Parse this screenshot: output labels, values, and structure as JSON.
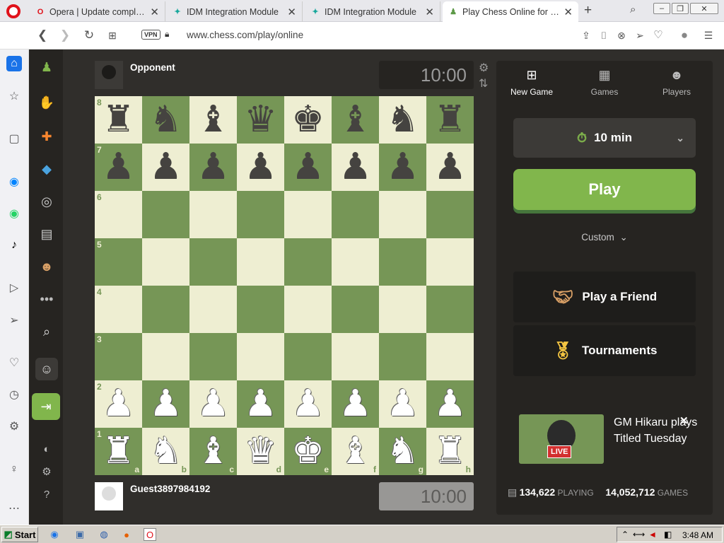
{
  "browser": {
    "tabs": [
      {
        "title": "Opera | Update complete",
        "icon": "opera-icon",
        "active": false
      },
      {
        "title": "IDM Integration Module",
        "icon": "idm-icon",
        "active": false
      },
      {
        "title": "IDM Integration Module",
        "icon": "idm-icon",
        "active": false
      },
      {
        "title": "Play Chess Online for FREE",
        "icon": "chess-pawn-icon",
        "active": true
      }
    ],
    "new_tab": "+",
    "url": "www.chess.com/play/online",
    "vpn_label": "VPN"
  },
  "game": {
    "opponent": {
      "name": "Opponent",
      "clock": "10:00"
    },
    "player": {
      "name": "Guest3897984192",
      "clock": "10:00"
    },
    "files": [
      "a",
      "b",
      "c",
      "d",
      "e",
      "f",
      "g",
      "h"
    ],
    "ranks": [
      "8",
      "7",
      "6",
      "5",
      "4",
      "3",
      "2",
      "1"
    ],
    "position": [
      [
        "r",
        "n",
        "b",
        "q",
        "k",
        "b",
        "n",
        "r"
      ],
      [
        "p",
        "p",
        "p",
        "p",
        "p",
        "p",
        "p",
        "p"
      ],
      [
        "",
        "",
        "",
        "",
        "",
        "",
        "",
        ""
      ],
      [
        "",
        "",
        "",
        "",
        "",
        "",
        "",
        ""
      ],
      [
        "",
        "",
        "",
        "",
        "",
        "",
        "",
        ""
      ],
      [
        "",
        "",
        "",
        "",
        "",
        "",
        "",
        ""
      ],
      [
        "P",
        "P",
        "P",
        "P",
        "P",
        "P",
        "P",
        "P"
      ],
      [
        "R",
        "N",
        "B",
        "Q",
        "K",
        "B",
        "N",
        "R"
      ]
    ],
    "colors": {
      "light": "#eeeed2",
      "dark": "#769656"
    }
  },
  "panel": {
    "tabs": [
      {
        "label": "New Game",
        "icon": "plus-square-icon"
      },
      {
        "label": "Games",
        "icon": "checkerboard-icon"
      },
      {
        "label": "Players",
        "icon": "players-icon"
      }
    ],
    "time_control": "10 min",
    "play_label": "Play",
    "custom_label": "Custom",
    "play_friend_label": "Play a Friend",
    "tournaments_label": "Tournaments",
    "live": {
      "badge": "LIVE",
      "text": "GM Hikaru plays Titled Tuesday"
    },
    "stats": {
      "playing_count": "134,622",
      "playing_label": "PLAYING",
      "games_count": "14,052,712",
      "games_label": "GAMES"
    },
    "accent": "#81b64c"
  },
  "taskbar": {
    "start_label": "Start",
    "time": "3:48 AM"
  }
}
